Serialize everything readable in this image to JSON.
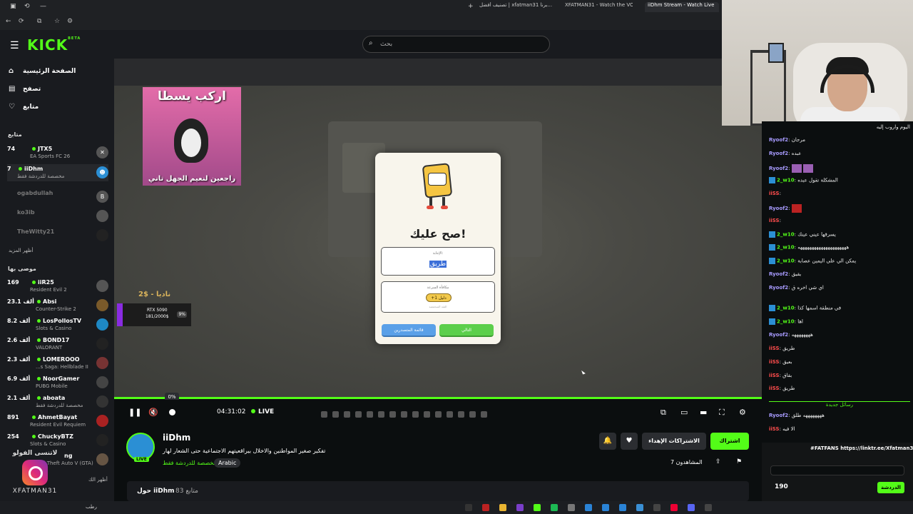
{
  "browser": {
    "tabs": [
      {
        "label": "تصنيف أفضل | xfatman31 برنا...",
        "active": false
      },
      {
        "label": "XFATMAN31 - Watch the VOD",
        "active": false
      },
      {
        "label": "iiDhm Stream - Watch Live",
        "active": true
      }
    ]
  },
  "header": {
    "logo": "KICK",
    "logo_tag": "BETA",
    "search_placeholder": "بحث"
  },
  "sidebar": {
    "nav": [
      {
        "label": "الصفحة الرئيسية",
        "icon": "home-icon"
      },
      {
        "label": "تصفح",
        "icon": "browse-icon"
      },
      {
        "label": "متابع",
        "icon": "heart-icon"
      }
    ],
    "following_title": "متابع",
    "following": [
      {
        "viewers": "74",
        "name": "JTX5",
        "game": "EA Sports FC 26"
      },
      {
        "viewers": "7",
        "name": "iiDhm",
        "game": "مخصصة للدردشة فقط"
      },
      {
        "viewers": "",
        "name": "ogabdullah",
        "game": ""
      },
      {
        "viewers": "",
        "name": "ko3ib",
        "game": ""
      },
      {
        "viewers": "",
        "name": "TheWitty21",
        "game": ""
      }
    ],
    "show_more": "أظهر المزيد",
    "recommended_title": "موصى بها",
    "recommended": [
      {
        "viewers": "169",
        "name": "iiR25",
        "game": "Resident Evil 2"
      },
      {
        "viewers": "23.1 ألف",
        "name": "Absi",
        "game": "Counter-Strike 2"
      },
      {
        "viewers": "8.2 ألف",
        "name": "LosPollosTV",
        "game": "Slots & Casino"
      },
      {
        "viewers": "2.6 ألف",
        "name": "BOND17",
        "game": "VALORANT"
      },
      {
        "viewers": "2.3 ألف",
        "name": "LOMEROOO",
        "game": "...s Saga: Hellblade II"
      },
      {
        "viewers": "6.9 ألف",
        "name": "NoorGamer",
        "game": "PUBG Mobile"
      },
      {
        "viewers": "2.1 ألف",
        "name": "aboata",
        "game": "مخصصة للدردشة فقط"
      },
      {
        "viewers": "891",
        "name": "AhmetBayat",
        "game": "Resident Evil Requiem"
      },
      {
        "viewers": "254",
        "name": "ChuckyBTZ",
        "game": "Slots & Casino"
      },
      {
        "viewers": "",
        "name": "ng",
        "game": "Grand Theft Auto V (GTA)"
      }
    ],
    "show_more2": "أظهر الك"
  },
  "instagram_overlay": {
    "top_text": "لاتنسى الفولو",
    "handle": "XFATMAN31"
  },
  "player": {
    "meme_top": "اركب يسطا",
    "meme_bottom": "راجعين لنعيم الجهل تاني",
    "goal_amount": "2$ - ناديا",
    "goal_line1": "RTX 5090",
    "goal_line2": "181/2000$",
    "goal_pct": "9%",
    "modal_title": "صح عليك!",
    "answer_label": "الإجابة:",
    "answer_value": "طريق",
    "bonus_label": "مكافأة السرعة",
    "bonus_value": "+1 دليل",
    "bonus_sub": "الثقة المنخفضة",
    "btn_blue": "قائمة المتصدرين",
    "btn_green": "التالي",
    "volume_tip": "0%",
    "time": "04:31:02",
    "live": "LIVE"
  },
  "stream": {
    "name": "iiDhm",
    "live_badge": "LIVE",
    "title": "تفكير صغير المواطنين والاخلال بيراقعيتهم الاجتماعية حتى الشعار لهار",
    "category": "مخصصة للدردشة فقط",
    "language": "Arabic",
    "subscribe": "اشتراك",
    "gift": "الاشتراكات الإهداء",
    "viewers": "المشاهدون 7",
    "about": "حول iiDhm",
    "followers": "83 متابع"
  },
  "chat": {
    "messages": [
      {
        "user": "",
        "text": "اليوم واروب إليه",
        "color": ""
      },
      {
        "user": "Ryoof2",
        "text": "مرجان",
        "color": "purple"
      },
      {
        "user": "Ryoof2",
        "text": "عبده",
        "color": "purple"
      },
      {
        "user": "Ryoof2",
        "text": "",
        "color": "purple"
      },
      {
        "user": "2_w10",
        "text": "المشكلة تقول عبده",
        "color": "green"
      },
      {
        "user": "iiSS",
        "text": "",
        "color": "red"
      },
      {
        "user": "Ryoof2",
        "text": "",
        "color": "purple"
      },
      {
        "user": "iiSS",
        "text": "",
        "color": "red"
      },
      {
        "user": "2_w10",
        "text": "يسرقها عيني عينك",
        "color": "green"
      },
      {
        "user": "2_w10",
        "text": "هههههههههههههههههههههه",
        "color": "green"
      },
      {
        "user": "2_w10",
        "text": "يمكن الي على اليمين عصابة",
        "color": "green"
      },
      {
        "user": "Ryoof2",
        "text": "يقيق",
        "color": "purple"
      },
      {
        "user": "Ryoof2",
        "text": "اي شي اخره ق",
        "color": "purple"
      },
      {
        "user": "2_w10",
        "text": "في منطقة اسمها كذا",
        "color": "green"
      },
      {
        "user": "2_w10",
        "text": "اها",
        "color": "green"
      },
      {
        "user": "Ryoof2",
        "text": "ههههههههه",
        "color": "purple"
      },
      {
        "user": "iiSS",
        "text": "طريق",
        "color": "red"
      },
      {
        "user": "iiSS",
        "text": "بعيق",
        "color": "red"
      },
      {
        "user": "iiSS",
        "text": "بقاق",
        "color": "red"
      },
      {
        "user": "iiSS",
        "text": "طريق",
        "color": "red"
      }
    ],
    "new_messages": "رسائل جديدة",
    "after": [
      {
        "user": "Ryoof2",
        "text": "ههههههههه طلق",
        "color": "purple"
      },
      {
        "user": "iiSS",
        "text": "الا فيه",
        "color": "red"
      }
    ],
    "bot_line": "#FATFANS https://linktr.ee/Xfatman31",
    "points": "190",
    "send": "الدردشة"
  },
  "colors": {
    "accent": "#53fc18",
    "chat_purple": "#a89bff",
    "chat_red": "#ff4d4d"
  },
  "taskbar": {
    "weather": "رطب"
  }
}
